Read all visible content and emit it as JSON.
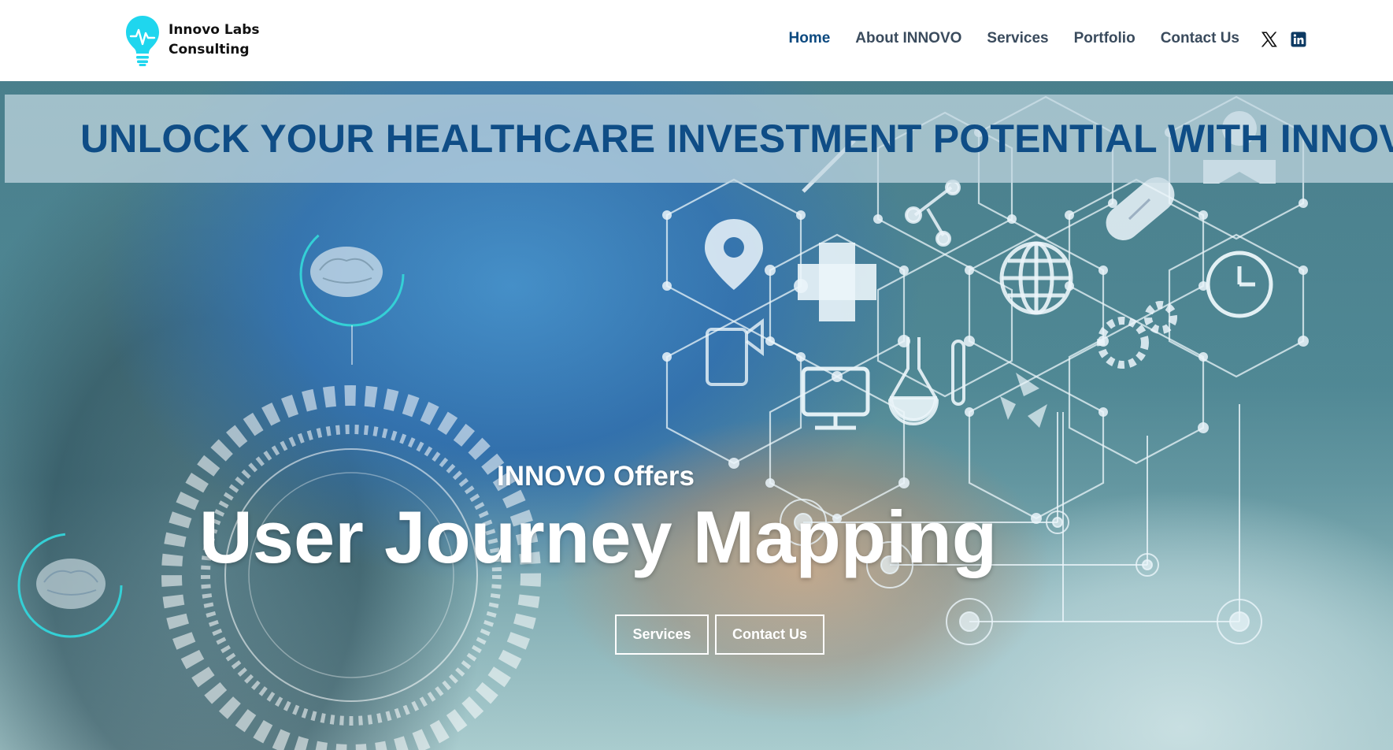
{
  "brand": {
    "line1": "Innovo Labs",
    "line2": "Consulting",
    "logo_icon": "lightbulb-pulse-icon",
    "logo_color": "#1fd6ee"
  },
  "nav": {
    "items": [
      {
        "label": "Home",
        "active": true
      },
      {
        "label": "About INNOVO",
        "active": false
      },
      {
        "label": "Services",
        "active": false
      },
      {
        "label": "Portfolio",
        "active": false
      },
      {
        "label": "Contact Us",
        "active": false
      }
    ],
    "active_color": "#0d4a80",
    "text_color": "#3a4b5d"
  },
  "social": {
    "items": [
      {
        "icon": "x-twitter-icon"
      },
      {
        "icon": "linkedin-icon"
      }
    ]
  },
  "hero": {
    "banner_title": "UNLOCK YOUR HEALTHCARE INVESTMENT POTENTIAL WITH INNOVO",
    "banner_color": "#0f4d86",
    "subtitle": "INNOVO Offers",
    "headline": "User Journey Mapping",
    "buttons": {
      "services": "Services",
      "contact": "Contact Us"
    },
    "background_icons": [
      "map-pin-icon",
      "medical-cross-icon",
      "molecule-icon",
      "globe-icon",
      "pill-icon",
      "clock-icon",
      "inhaler-icon",
      "flask-icon",
      "test-tube-icon",
      "monitor-icon",
      "gears-icon",
      "recycle-icon",
      "syringe-icon",
      "doctor-icon",
      "brain-icon"
    ]
  }
}
